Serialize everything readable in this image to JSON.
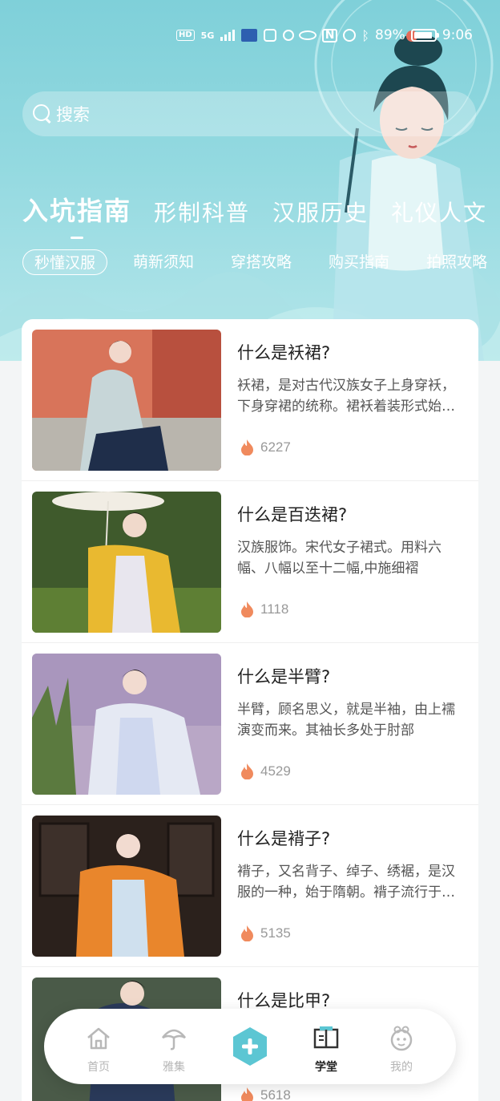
{
  "status_bar": {
    "hd": "HD",
    "net": "5G",
    "battery": "89%",
    "time": "9:06"
  },
  "search": {
    "placeholder": "搜索"
  },
  "categories": [
    {
      "label": "入坑指南",
      "active": true
    },
    {
      "label": "形制科普",
      "active": false
    },
    {
      "label": "汉服历史",
      "active": false
    },
    {
      "label": "礼仪人文",
      "active": false
    }
  ],
  "subtabs": [
    {
      "label": "秒懂汉服",
      "active": true
    },
    {
      "label": "萌新须知",
      "active": false
    },
    {
      "label": "穿搭攻略",
      "active": false
    },
    {
      "label": "购买指南",
      "active": false
    },
    {
      "label": "拍照攻略",
      "active": false
    }
  ],
  "articles": [
    {
      "title": "什么是袄裙?",
      "desc": "袄裙，是对古代汉族女子上身穿袄，下身穿裙的统称。裙袄着装形式始于汉代",
      "views": "6227"
    },
    {
      "title": "什么是百迭裙?",
      "desc": "汉族服饰。宋代女子裙式。用料六幅、八幅以至十二幅,中施细褶",
      "views": "1118"
    },
    {
      "title": "什么是半臂?",
      "desc": "半臂，顾名思义，就是半袖，由上襦演变而来。其袖长多处于肘部",
      "views": "4529"
    },
    {
      "title": "什么是褙子?",
      "desc": "褙子，又名背子、绰子、绣裾，是汉服的一种，始于隋朝。褙子流行于宋代",
      "views": "5135"
    },
    {
      "title": "什么是比甲?",
      "desc": "",
      "views": "5618"
    }
  ],
  "tabbar": {
    "items": [
      {
        "label": "首页",
        "icon": "home-icon",
        "active": false
      },
      {
        "label": "雅集",
        "icon": "umbrella-icon",
        "active": false
      },
      {
        "label": "",
        "icon": "plus-icon",
        "active": false
      },
      {
        "label": "学堂",
        "icon": "book-icon",
        "active": true
      },
      {
        "label": "我的",
        "icon": "profile-icon",
        "active": false
      }
    ]
  },
  "colors": {
    "accent": "#5cc6d3",
    "fire": "#f08a5d",
    "title": "#222222"
  }
}
